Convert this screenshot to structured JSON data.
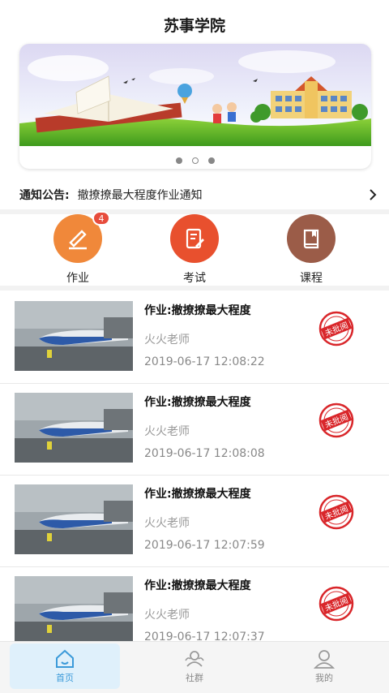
{
  "app": {
    "title": "苏事学院"
  },
  "banner": {
    "dots": 3,
    "active_dot": 1
  },
  "notice": {
    "label": "通知公告:",
    "text": "撤撩撩最大程度作业通知"
  },
  "quick": {
    "homework": {
      "label": "作业",
      "badge": "4",
      "color": "#f0883a"
    },
    "exam": {
      "label": "考试",
      "color": "#e8502e"
    },
    "course": {
      "label": "课程",
      "color": "#9b5c48"
    }
  },
  "list": [
    {
      "title": "作业:撤撩撩最大程度",
      "teacher": "火火老师",
      "time": "2019-06-17 12:08:22",
      "stamp": "未批阅"
    },
    {
      "title": "作业:撤撩撩最大程度",
      "teacher": "火火老师",
      "time": "2019-06-17 12:08:08",
      "stamp": "未批阅"
    },
    {
      "title": "作业:撤撩撩最大程度",
      "teacher": "火火老师",
      "time": "2019-06-17 12:07:59",
      "stamp": "未批阅"
    },
    {
      "title": "作业:撤撩撩最大程度",
      "teacher": "火火老师",
      "time": "2019-06-17 12:07:37",
      "stamp": "未批阅"
    }
  ],
  "tabs": {
    "home": {
      "label": "首页",
      "icon": "home-icon"
    },
    "community": {
      "label": "社群",
      "icon": "community-icon"
    },
    "mine": {
      "label": "我的",
      "icon": "user-icon"
    }
  },
  "colors": {
    "accent": "#3b9ad9",
    "stamp": "#d9262a",
    "badge": "#e74c3c"
  }
}
